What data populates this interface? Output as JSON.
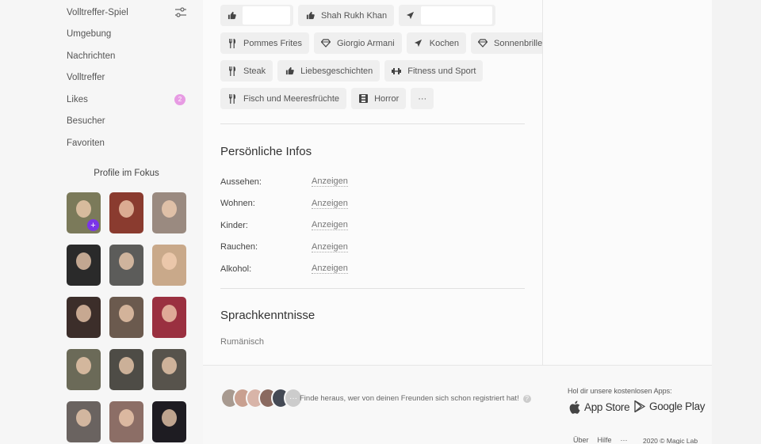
{
  "sidebar": {
    "nav": [
      {
        "label": "Volltreffer-Spiel"
      },
      {
        "label": "Umgebung"
      },
      {
        "label": "Nachrichten"
      },
      {
        "label": "Volltreffer"
      },
      {
        "label": "Likes",
        "badge": "2"
      },
      {
        "label": "Besucher"
      },
      {
        "label": "Favoriten"
      }
    ],
    "focus_title": "Profile im Fokus",
    "thumbs": [
      {
        "color": "#7b7a5a"
      },
      {
        "color": "#8a3b2f"
      },
      {
        "color": "#9a8a80"
      },
      {
        "color": "#2a2a2a"
      },
      {
        "color": "#5c5c5a"
      },
      {
        "color": "#c9a98a"
      },
      {
        "color": "#3c2e2a"
      },
      {
        "color": "#6b5a4e"
      },
      {
        "color": "#9a3040"
      },
      {
        "color": "#6b6a58"
      },
      {
        "color": "#4e4c46"
      },
      {
        "color": "#57534c"
      },
      {
        "color": "#6a6360"
      },
      {
        "color": "#8c6e66"
      },
      {
        "color": "#1e1c22"
      }
    ]
  },
  "interests": {
    "row1": [
      "Shah Rukh Khan"
    ],
    "row2": [
      "Pommes Frites",
      "Giorgio Armani",
      "Kochen",
      "Sonnenbrillen"
    ],
    "row3": [
      "Steak",
      "Liebesgeschichten",
      "Fitness und Sport"
    ],
    "row4": [
      "Fisch und Meeresfrüchte",
      "Horror"
    ],
    "more": "···"
  },
  "personal": {
    "title": "Persönliche Infos",
    "rows": [
      {
        "label": "Aussehen:",
        "value": "Anzeigen"
      },
      {
        "label": "Wohnen:",
        "value": "Anzeigen"
      },
      {
        "label": "Kinder:",
        "value": "Anzeigen"
      },
      {
        "label": "Rauchen:",
        "value": "Anzeigen"
      },
      {
        "label": "Alkohol:",
        "value": "Anzeigen"
      }
    ]
  },
  "languages": {
    "title": "Sprachkenntnisse",
    "value": "Rumänisch"
  },
  "footer": {
    "invite_text": "Finde heraus, wer von deinen Freunden sich schon registriert hat!",
    "help": "?",
    "more": "···",
    "apps_title": "Hol dir unsere kostenlosen Apps:",
    "app_store": "App Store",
    "google_play": "Google Play",
    "links": [
      "Über",
      "Hilfe",
      "···"
    ],
    "copyright": "2020 © Magic Lab"
  },
  "colors": {
    "accent": "#7b35e8",
    "badge": "#e79be3"
  }
}
